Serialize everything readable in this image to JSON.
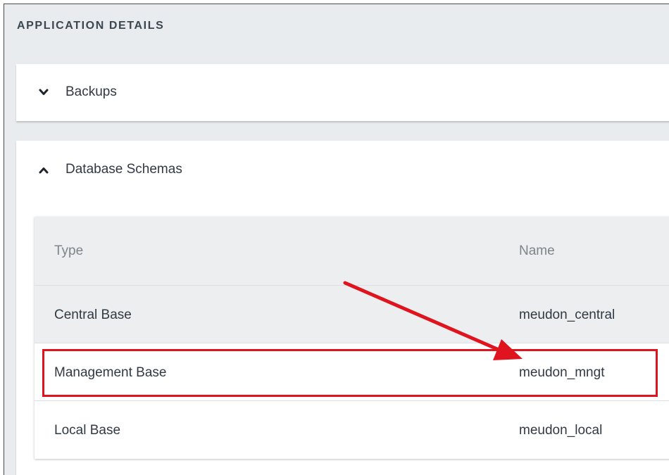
{
  "section": {
    "title": "APPLICATION DETAILS"
  },
  "panels": [
    {
      "label": "Backups",
      "expanded": false,
      "icon": "chevron-down-icon"
    },
    {
      "label": "Database Schemas",
      "expanded": true,
      "icon": "chevron-up-icon"
    }
  ],
  "schemas_table": {
    "columns": [
      "Type",
      "Name"
    ],
    "rows": [
      {
        "type": "Central Base",
        "name": "meudon_central"
      },
      {
        "type": "Management Base",
        "name": "meudon_mngt"
      },
      {
        "type": "Local Base",
        "name": "meudon_local"
      }
    ]
  },
  "annotation": {
    "color": "#e0141e",
    "highlighted_row": "Management Base"
  }
}
